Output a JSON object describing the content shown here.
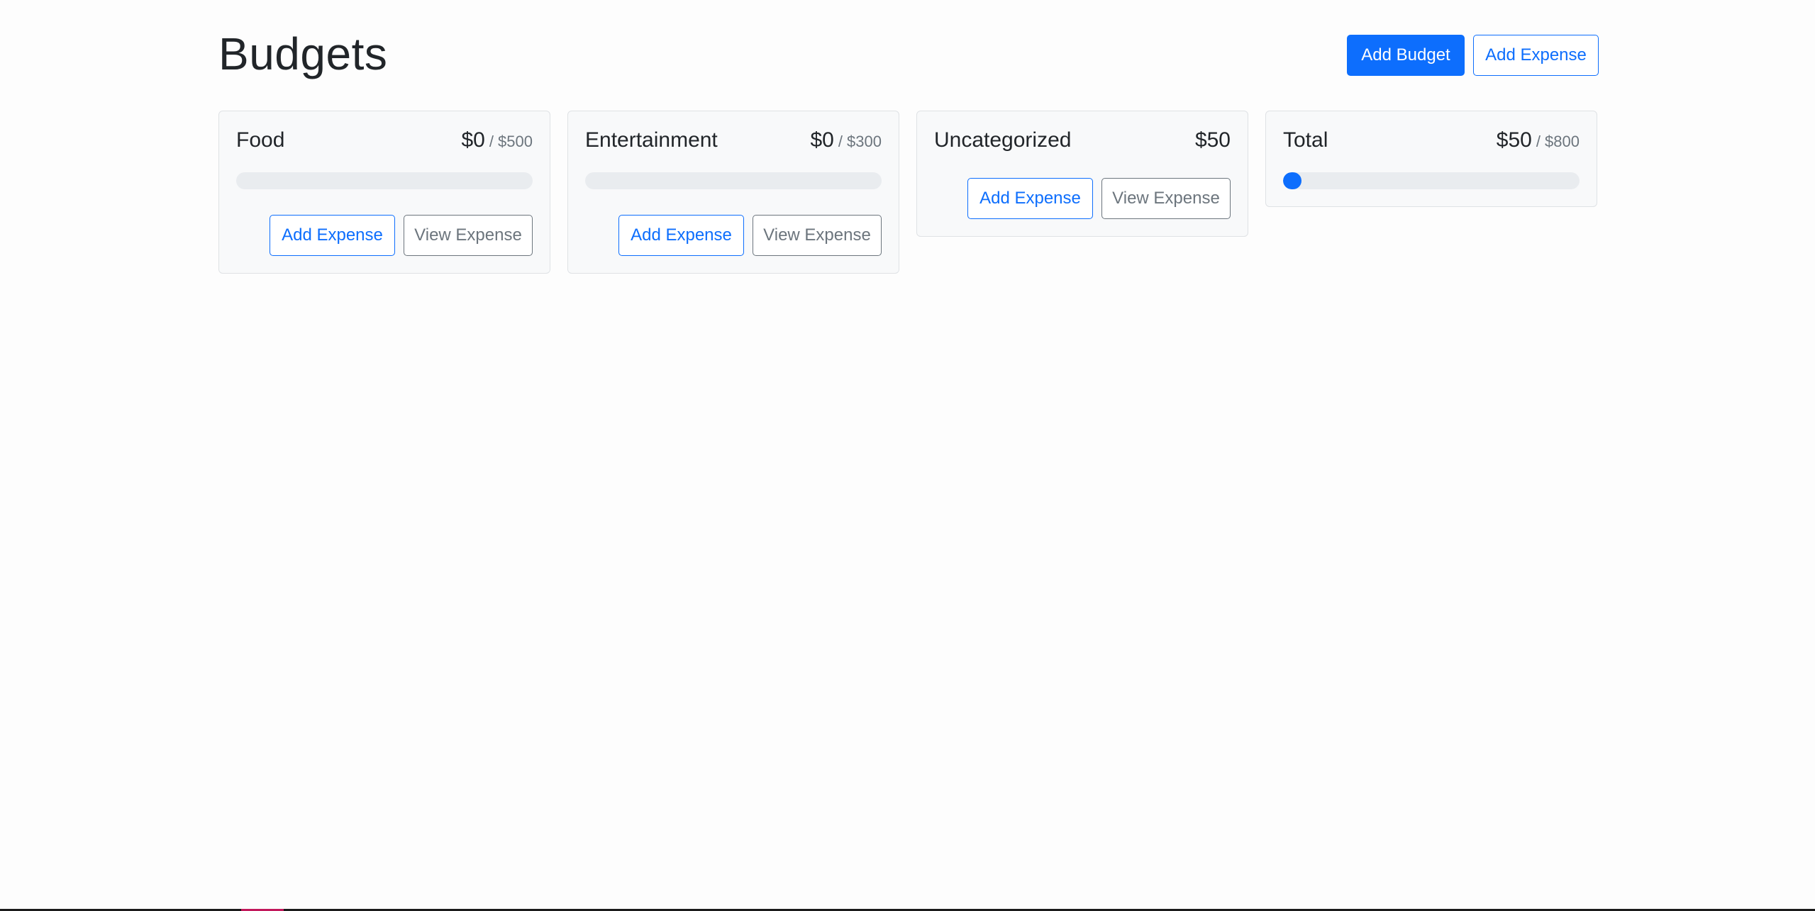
{
  "header": {
    "title": "Budgets",
    "add_budget_label": "Add Budget",
    "add_expense_label": "Add Expense"
  },
  "budgets": [
    {
      "name": "Food",
      "amount": "$0",
      "max": "/ $500",
      "progress": 0,
      "add_expense_label": "Add Expense",
      "view_expense_label": "View Expense"
    },
    {
      "name": "Entertainment",
      "amount": "$0",
      "max": "/ $300",
      "progress": 0,
      "add_expense_label": "Add Expense",
      "view_expense_label": "View Expense"
    },
    {
      "name": "Uncategorized",
      "amount": "$50",
      "add_expense_label": "Add Expense",
      "view_expense_label": "View Expense"
    },
    {
      "name": "Total",
      "amount": "$50",
      "max": "/ $800",
      "progress": 0.0625
    }
  ],
  "colors": {
    "primary": "#0d6efd",
    "secondary": "#6c757d",
    "card_bg": "#f8f9fa",
    "progress_track": "#e9ecef"
  }
}
